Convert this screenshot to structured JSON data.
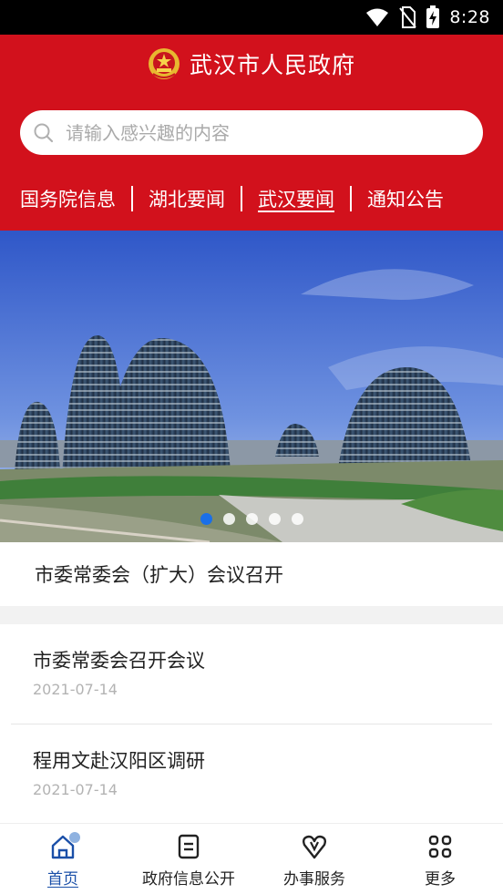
{
  "status_bar": {
    "time": "8:28",
    "icons": [
      "wifi-icon",
      "no-sim-icon",
      "battery-charging-icon"
    ]
  },
  "header": {
    "title": "武汉市人民政府",
    "emblem_icon": "national-emblem-icon",
    "background_color": "#d2111c"
  },
  "search": {
    "placeholder": "请输入感兴趣的内容",
    "icon": "search-icon"
  },
  "tabs": [
    {
      "label": "国务院信息",
      "active": false
    },
    {
      "label": "湖北要闻",
      "active": false
    },
    {
      "label": "武汉要闻",
      "active": true
    },
    {
      "label": "通知公告",
      "active": false
    }
  ],
  "banner": {
    "slide_count": 5,
    "active_index": 0,
    "active_dot_color": "#1a6fe8"
  },
  "headline": "市委常委会（扩大）会议召开",
  "news": [
    {
      "title": "市委常委会召开会议",
      "date": "2021-07-14"
    },
    {
      "title": "程用文赴汉阳区调研",
      "date": "2021-07-14"
    }
  ],
  "bottom_nav": [
    {
      "label": "首页",
      "icon": "home-icon",
      "active": true
    },
    {
      "label": "政府信息公开",
      "icon": "document-icon",
      "active": false
    },
    {
      "label": "办事服务",
      "icon": "heart-icon",
      "active": false
    },
    {
      "label": "更多",
      "icon": "grid-icon",
      "active": false
    }
  ],
  "accent_color": "#1a4fa8"
}
